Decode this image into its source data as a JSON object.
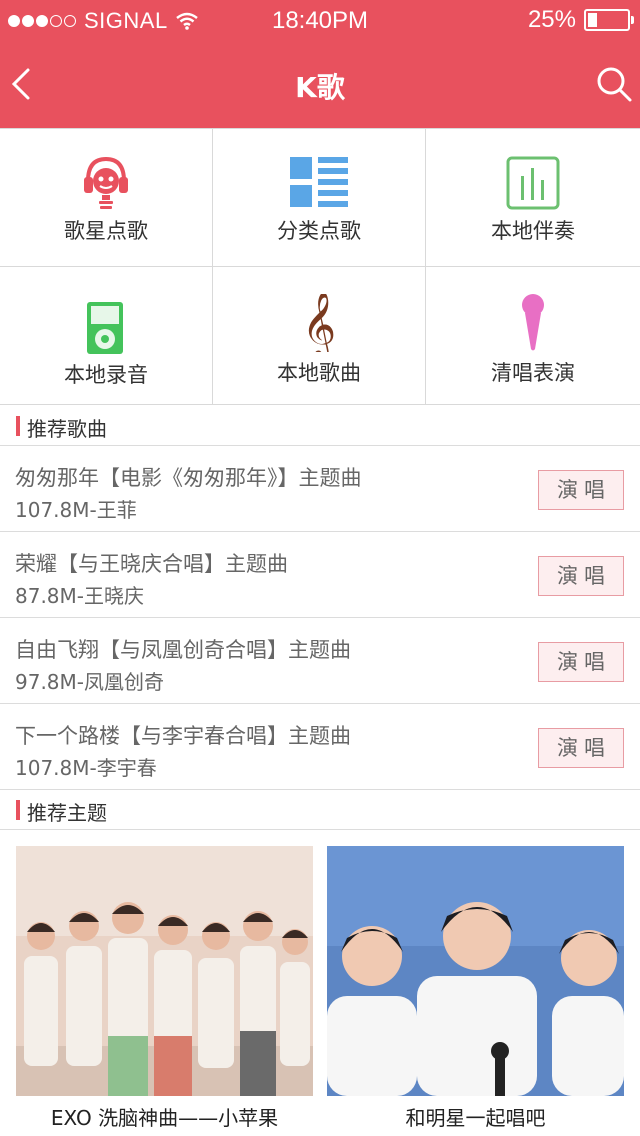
{
  "status": {
    "carrier": "SIGNAL",
    "time": "18:40PM",
    "battery": "25%"
  },
  "nav": {
    "title": "K歌"
  },
  "features": [
    {
      "label": "歌星点歌",
      "icon": "singer-headphones-icon",
      "color": "#e8515e"
    },
    {
      "label": "分类点歌",
      "icon": "category-list-icon",
      "color": "#5aa6e6"
    },
    {
      "label": "本地伴奏",
      "icon": "equalizer-icon",
      "color": "#6cc070"
    },
    {
      "label": "本地录音",
      "icon": "recorder-device-icon",
      "color": "#44c35b"
    },
    {
      "label": "本地歌曲",
      "icon": "treble-clef-icon",
      "color": "#7a3a1f"
    },
    {
      "label": "清唱表演",
      "icon": "microphone-icon",
      "color": "#e86fc4"
    }
  ],
  "recommended_songs": {
    "title": "推荐歌曲",
    "items": [
      {
        "name": "匆匆那年【电影《匆匆那年》】主题曲",
        "meta": "107.8M-王菲",
        "action": "演唱"
      },
      {
        "name": "荣耀【与王晓庆合唱】主题曲",
        "meta": "87.8M-王晓庆",
        "action": "演唱"
      },
      {
        "name": "自由飞翔【与凤凰创奇合唱】主题曲",
        "meta": "97.8M-凤凰创奇",
        "action": "演唱"
      },
      {
        "name": "下一个路楼【与李宇春合唱】主题曲",
        "meta": "107.8M-李宇春",
        "action": "演唱"
      }
    ]
  },
  "recommended_themes": {
    "title": "推荐主题",
    "items": [
      {
        "caption": "EXO 洗脑神曲——小苹果"
      },
      {
        "caption": "和明星一起唱吧"
      }
    ]
  },
  "colors": {
    "accent": "#e8515e",
    "button_bg": "#fdeeef"
  }
}
